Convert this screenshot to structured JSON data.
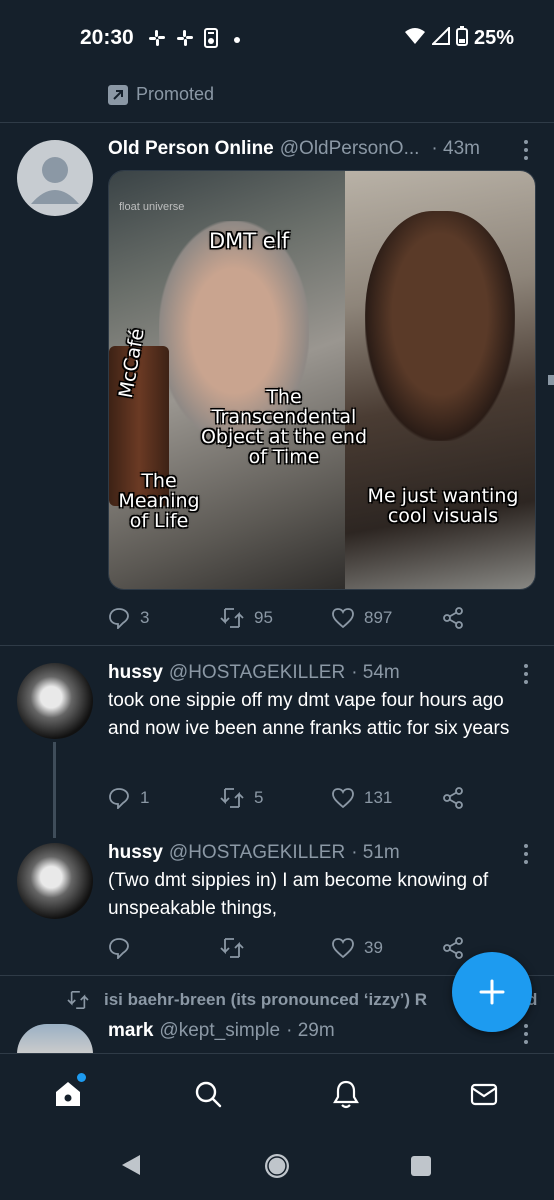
{
  "status_bar": {
    "time": "20:30",
    "notification_icons": [
      "slack-icon",
      "slack-icon",
      "tv-icon",
      "dot-icon"
    ],
    "battery": "25%"
  },
  "promoted": {
    "label": "Promoted"
  },
  "tweets": [
    {
      "name": "Old Person Online",
      "handle": "@OldPersonO...",
      "time": "· 43m",
      "media": {
        "watermark": "float universe",
        "labels": {
          "dmt_elf": "DMT elf",
          "transcendental": "The Transcendental Object at the end of Time",
          "meaning": "The Meaning of Life",
          "visuals": "Me just wanting cool visuals",
          "cup_brand": "McCafé"
        }
      },
      "replies": "3",
      "retweets": "95",
      "likes": "897"
    },
    {
      "name": "hussy",
      "handle": "@HOSTAGEKILLER",
      "time": "· 54m",
      "text": "took one sippie off my dmt vape four hours ago and now  ive been anne franks attic for six years",
      "replies": "1",
      "retweets": "5",
      "likes": "131"
    },
    {
      "name": "hussy",
      "handle": "@HOSTAGEKILLER",
      "time": "· 51m",
      "text": "(Two dmt sippies in) I am become knowing of unspeakable things,",
      "replies": "",
      "retweets": "",
      "likes": "39"
    },
    {
      "retweet_context": "isi baehr-breen (its pronounced ‘izzy’) R",
      "retweet_context_tail": "d",
      "name": "mark",
      "handle": "@kept_simple",
      "time": "· 29m"
    }
  ],
  "colors": {
    "background": "#15202b",
    "accent": "#1d9bf0",
    "secondary_text": "#8b98a5"
  },
  "bottom_nav": [
    "home-icon",
    "search-icon",
    "notifications-icon",
    "messages-icon"
  ]
}
